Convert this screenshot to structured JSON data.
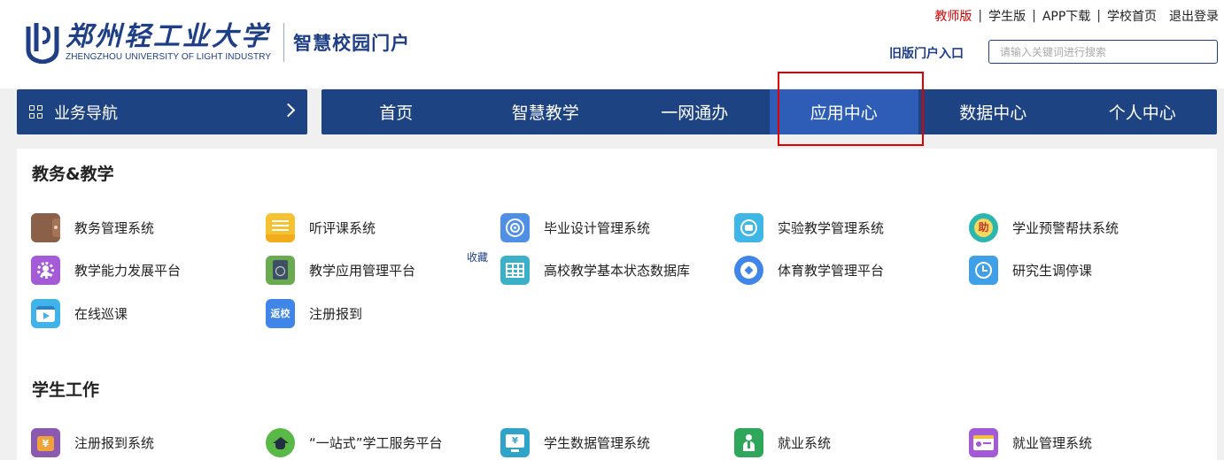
{
  "header": {
    "logo_cn": "郑州轻工业大学",
    "logo_en": "ZHENGZHOU UNIVERSITY OF LIGHT INDUSTRY",
    "portal_name": "智慧校园门户",
    "top_links": [
      "教师版",
      "学生版",
      "APP下载",
      "学校首页",
      "退出登录"
    ],
    "old_portal": "旧版门户入口",
    "search_placeholder": "请输入关键词进行搜索",
    "active_color": "#d10000"
  },
  "nav": {
    "business_nav": "业务导航",
    "tabs": [
      "首页",
      "智慧教学",
      "一网通办",
      "应用中心",
      "数据中心",
      "个人中心"
    ],
    "active_tab": "应用中心",
    "bar_color": "#1e4383",
    "active_color": "#2d5db6"
  },
  "sections": [
    {
      "title": "教务&教学",
      "favorite_label": "收藏",
      "apps": [
        {
          "label": "教务管理系统",
          "icon": "wallet-icon"
        },
        {
          "label": "听评课系统",
          "icon": "notes-icon"
        },
        {
          "label": "毕业设计管理系统",
          "icon": "target-icon"
        },
        {
          "label": "实验教学管理系统",
          "icon": "lab-icon"
        },
        {
          "label": "学业预警帮扶系统",
          "icon": "help-icon",
          "glyph": "助"
        },
        {
          "label": "教学能力发展平台",
          "icon": "gear-person-icon"
        },
        {
          "label": "教学应用管理平台",
          "icon": "book-globe-icon"
        },
        {
          "label": "高校教学基本状态数据库",
          "icon": "table-icon"
        },
        {
          "label": "体育教学管理平台",
          "icon": "football-icon"
        },
        {
          "label": "研究生调停课",
          "icon": "clock-calendar-icon"
        },
        {
          "label": "在线巡课",
          "icon": "video-icon"
        },
        {
          "label": "注册报到",
          "icon": "return-school-icon",
          "glyph": "返校"
        }
      ]
    },
    {
      "title": "学生工作",
      "apps": [
        {
          "label": "注册报到系统",
          "icon": "yuan-bag-icon",
          "glyph": "¥"
        },
        {
          "label": "“一站式”学工服务平台",
          "icon": "grad-cap-icon"
        },
        {
          "label": "学生数据管理系统",
          "icon": "monitor-yuan-icon",
          "glyph": "¥"
        },
        {
          "label": "就业系统",
          "icon": "person-tie-icon"
        },
        {
          "label": "就业管理系统",
          "icon": "id-card-icon"
        }
      ]
    }
  ]
}
